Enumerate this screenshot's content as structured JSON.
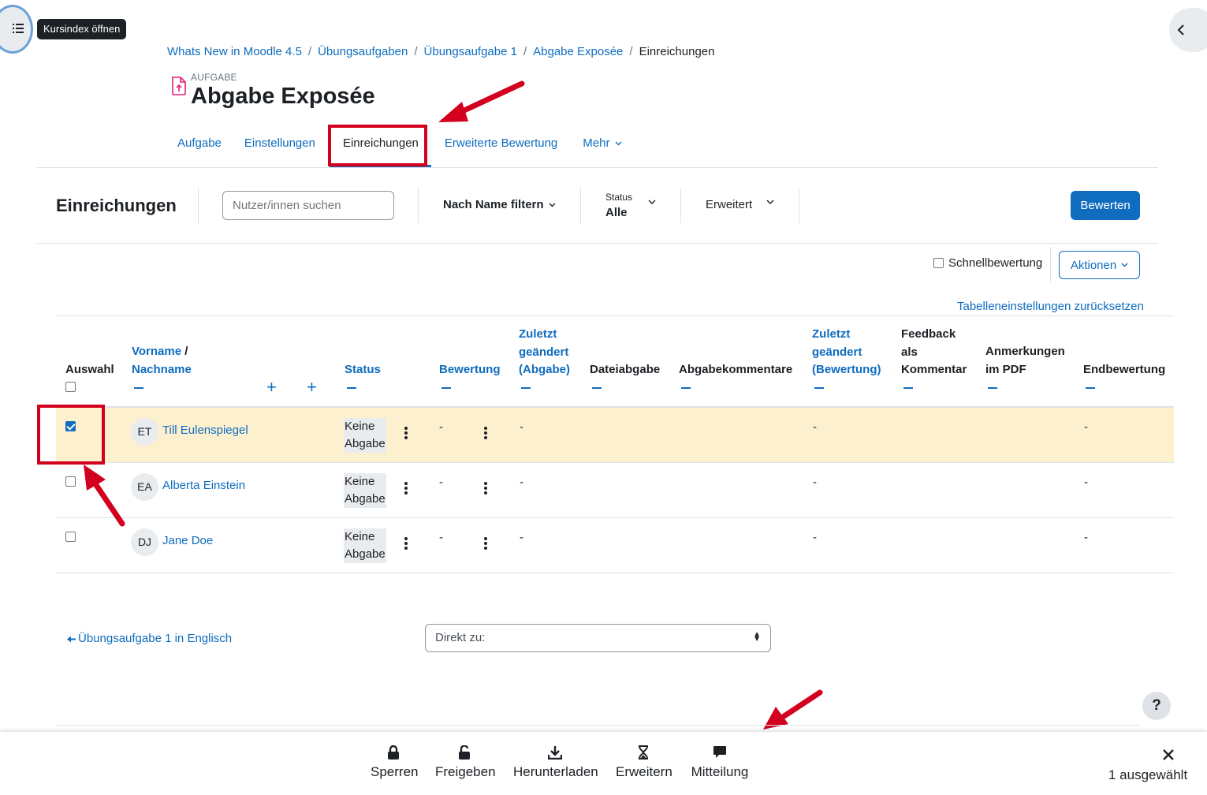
{
  "drawer": {
    "tooltip": "Kursindex öffnen",
    "icon": "list-icon"
  },
  "breadcrumb": [
    "Whats New in Moodle 4.5",
    "Übungsaufgaben",
    "Übungsaufgabe 1",
    "Abgabe Exposée",
    "Einreichungen"
  ],
  "header": {
    "kind": "AUFGABE",
    "title": "Abgabe Exposée"
  },
  "tabs": [
    "Aufgabe",
    "Einstellungen",
    "Einreichungen",
    "Erweiterte Bewertung",
    "Mehr"
  ],
  "toolbar": {
    "title": "Einreichungen",
    "search_placeholder": "Nutzer/innen suchen",
    "filter_label": "Nach Name filtern",
    "status_label": "Status",
    "status_value": "Alle",
    "advanced_label": "Erweitert",
    "grade_button": "Bewerten"
  },
  "actions": {
    "quick_grading": "Schnellbewertung",
    "actions_button": "Aktionen",
    "reset_table": "Tabelleneinstellungen zurücksetzen"
  },
  "table": {
    "headers": {
      "select": "Auswahl",
      "name_first": "Vorname",
      "name_sep": "/",
      "name_last": "Nachname",
      "status": "Status",
      "grade": "Bewertung",
      "modified_sub_1": "Zuletzt",
      "modified_sub_2": "geändert",
      "modified_sub_3": "(Abgabe)",
      "file": "Dateiabgabe",
      "comments": "Abgabekommentare",
      "modified_grade_1": "Zuletzt",
      "modified_grade_2": "geändert",
      "modified_grade_3": "(Bewertung)",
      "feedback_1": "Feedback",
      "feedback_2": "als",
      "feedback_3": "Kommentar",
      "annot_1": "Anmerkungen",
      "annot_2": "im PDF",
      "final": "Endbewertung"
    },
    "rows": [
      {
        "initials": "ET",
        "name": "Till Eulenspiegel",
        "status_1": "Keine",
        "status_2": "Abgabe",
        "grade": "-",
        "modified": "-",
        "modified_grade": "-",
        "final": "-",
        "selected": true
      },
      {
        "initials": "EA",
        "name": "Alberta Einstein",
        "status_1": "Keine",
        "status_2": "Abgabe",
        "grade": "-",
        "modified": "-",
        "modified_grade": "-",
        "final": "-",
        "selected": false
      },
      {
        "initials": "DJ",
        "name": "Jane Doe",
        "status_1": "Keine",
        "status_2": "Abgabe",
        "grade": "-",
        "modified": "-",
        "modified_grade": "-",
        "final": "-",
        "selected": false
      }
    ]
  },
  "footer": {
    "prev_link": "Übungsaufgabe 1 in Englisch",
    "jump_placeholder": "Direkt zu:",
    "help": "?"
  },
  "sticky": {
    "buttons": [
      {
        "label": "Sperren",
        "icon": "lock-icon"
      },
      {
        "label": "Freigeben",
        "icon": "unlock-icon"
      },
      {
        "label": "Herunterladen",
        "icon": "download-icon"
      },
      {
        "label": "Erweitern",
        "icon": "hourglass-icon"
      },
      {
        "label": "Mitteilung",
        "icon": "message-icon"
      }
    ],
    "selected_count": "1 ausgewählt"
  },
  "colors": {
    "accent": "#0f6cbf",
    "highlight": "#d2001e",
    "selected_row": "#fdf0cf"
  }
}
